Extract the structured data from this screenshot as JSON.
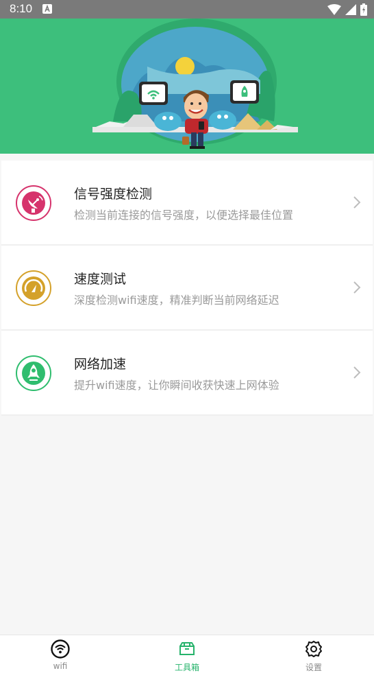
{
  "status_bar": {
    "time": "8:10",
    "notification_icon": "a-notification-icon",
    "wifi_icon": "wifi-icon",
    "signal_icon": "signal-icon",
    "battery_icon": "battery-icon"
  },
  "banner": {
    "illustration": "man-with-phone-wifi-illustration",
    "background_color": "#3dbf7c"
  },
  "items": [
    {
      "title": "信号强度检测",
      "desc": "检测当前连接的信号强度，以便选择最佳位置",
      "icon": "satellite-dish-icon",
      "color": "#d6336c"
    },
    {
      "title": "速度测试",
      "desc": "深度检测wifi速度，精准判断当前网络延迟",
      "icon": "speedometer-icon",
      "color": "#d4a12a"
    },
    {
      "title": "网络加速",
      "desc": "提升wifi速度，让你瞬间收获快速上网体验",
      "icon": "rocket-icon",
      "color": "#2fbd6e"
    }
  ],
  "tabs": [
    {
      "label": "wifi",
      "icon": "wifi-circle-icon",
      "active": false
    },
    {
      "label": "工具箱",
      "icon": "toolbox-icon",
      "active": true
    },
    {
      "label": "设置",
      "icon": "gear-icon",
      "active": false
    }
  ],
  "colors": {
    "accent": "#26b36b",
    "inactive": "#8a8a8a"
  }
}
